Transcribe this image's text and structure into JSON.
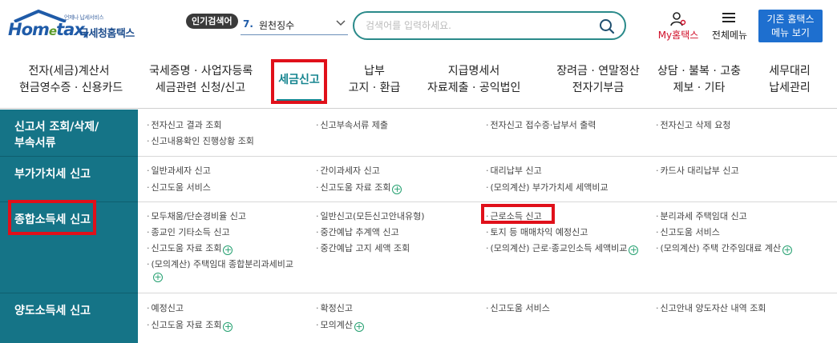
{
  "header": {
    "logo_small": "언제나 납세서비스",
    "logo_brand_home": "Hom",
    "logo_brand_e": "e",
    "logo_brand_tax": "tax,",
    "logo_sub": "국세청홈택스",
    "popular_badge": "인기검색어",
    "popular_rank": "7.",
    "popular_term": "원천징수",
    "search_placeholder": "검색어를 입력하세요.",
    "my_hometax": "My홈택스",
    "all_menu": "전체메뉴",
    "classic_line1": "기존 홈택스",
    "classic_line2": "메뉴 보기"
  },
  "nav": [
    {
      "line1": "전자(세금)계산서",
      "line2": "현금영수증 · 신용카드"
    },
    {
      "line1": "국세증명 · 사업자등록",
      "line2": "세금관련 신청/신고"
    },
    {
      "line1": "세금신고",
      "line2": ""
    },
    {
      "line1": "납부",
      "line2": "고지 · 환급"
    },
    {
      "line1": "지급명세서",
      "line2": "자료제출 · 공익법인"
    },
    {
      "line1": "장려금 · 연말정산",
      "line2": "전자기부금"
    },
    {
      "line1": "상담 · 불복 · 고충",
      "line2": "제보 · 기타"
    },
    {
      "line1": "세무대리",
      "line2": "납세관리"
    }
  ],
  "rows": [
    {
      "head1": "신고서 조회/삭제/",
      "head2": "부속서류",
      "cells": [
        "전자신고 결과 조회",
        "신고부속서류 제출",
        "전자신고 접수증·납부서 출력",
        "전자신고 삭제 요청",
        "신고내용확인 진행상황 조회"
      ]
    },
    {
      "head1": "부가가치세 신고",
      "head2": "",
      "cells": [
        "일반과세자 신고",
        "간이과세자 신고",
        "대리납부 신고",
        "카드사 대리납부 신고",
        "신고도움 서비스",
        "신고도움 자료 조회",
        "(모의계산) 부가가치세 세액비교"
      ]
    },
    {
      "head1": "종합소득세 신고",
      "head2": "",
      "cells": [
        "모두채움/단순경비율 신고",
        "일반신고(모든신고안내유형)",
        "근로소득 신고",
        "분리과세 주택임대 신고",
        "종교인 기타소득 신고",
        "중간예납 추계액 신고",
        "토지 등 매매차익 예정신고",
        "신고도움 서비스",
        "신고도움 자료 조회",
        "중간예납 고지 세액 조회",
        "(모의계산) 근로·종교인소득 세액비교",
        "(모의계산) 주택 간주임대료 계산",
        "(모의계산) 주택임대 종합분리과세비교"
      ]
    },
    {
      "head1": "양도소득세 신고",
      "head2": "",
      "cells": [
        "예정신고",
        "확정신고",
        "신고도움 서비스",
        "신고안내 양도자산 내역 조회",
        "신고도움 자료 조회",
        "모의계산"
      ]
    }
  ]
}
